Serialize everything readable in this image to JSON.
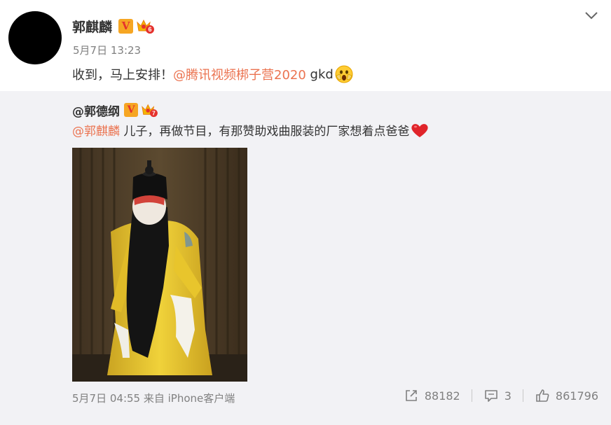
{
  "post": {
    "author": "郭麒麟",
    "verified_badge": "V",
    "timestamp": "5月7日 13:23",
    "text": "收到，马上安排！",
    "mention": "@腾讯视频梆子营2020",
    "text_suffix": " gkd",
    "emoji_icon": "scream-face-emoji",
    "crown_level": "6",
    "menu_icon": "chevron-down-icon"
  },
  "repost": {
    "author": "@郭德纲",
    "verified_badge": "V",
    "crown_level": "7",
    "mention": "@郭麒麟",
    "text": " 儿子，再做节目，有那赞助戏曲服装的厂家想着点爸爸",
    "emoji_icon": "heart-emoji",
    "image_icon": "opera-performer-photo",
    "meta": "5月7日 04:55 来自 iPhone客户端",
    "actions": {
      "repost_count": "88182",
      "comment_count": "3",
      "like_count": "861796"
    }
  },
  "colors": {
    "mention": "#eb7350",
    "repost_bg": "#f2f2f5",
    "meta_text": "#808080",
    "badge_bg": "#f6a623",
    "badge_v": "#e5322d"
  }
}
